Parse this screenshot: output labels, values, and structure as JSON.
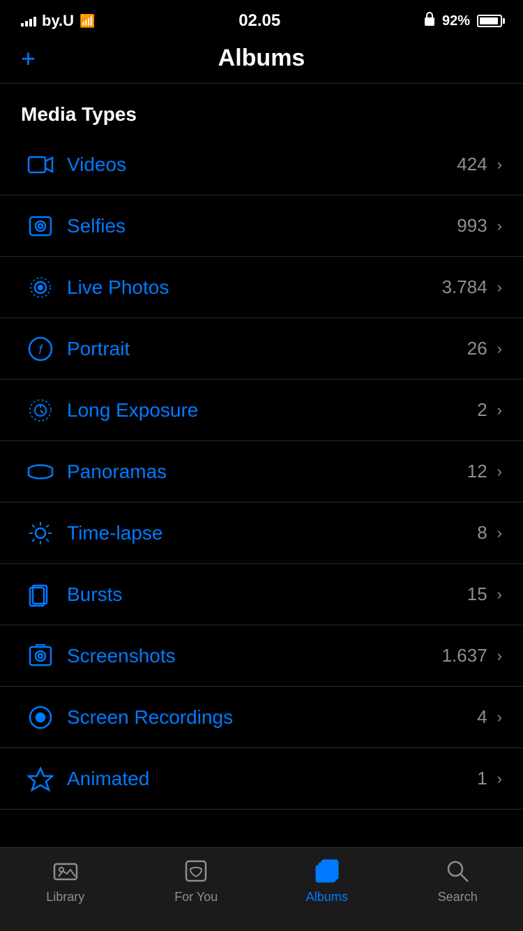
{
  "statusBar": {
    "carrier": "by.U",
    "time": "02.05",
    "batteryPercent": "92%",
    "lockIcon": "🔒"
  },
  "header": {
    "addButton": "+",
    "title": "Albums"
  },
  "mediaTypes": {
    "sectionTitle": "Media Types",
    "items": [
      {
        "id": "videos",
        "label": "Videos",
        "count": "424",
        "icon": "video"
      },
      {
        "id": "selfies",
        "label": "Selfies",
        "count": "993",
        "icon": "selfie"
      },
      {
        "id": "live-photos",
        "label": "Live Photos",
        "count": "3.784",
        "icon": "live"
      },
      {
        "id": "portrait",
        "label": "Portrait",
        "count": "26",
        "icon": "portrait"
      },
      {
        "id": "long-exposure",
        "label": "Long Exposure",
        "count": "2",
        "icon": "long-exposure"
      },
      {
        "id": "panoramas",
        "label": "Panoramas",
        "count": "12",
        "icon": "panorama"
      },
      {
        "id": "time-lapse",
        "label": "Time-lapse",
        "count": "8",
        "icon": "timelapse"
      },
      {
        "id": "bursts",
        "label": "Bursts",
        "count": "15",
        "icon": "bursts"
      },
      {
        "id": "screenshots",
        "label": "Screenshots",
        "count": "1.637",
        "icon": "screenshot"
      },
      {
        "id": "screen-recordings",
        "label": "Screen Recordings",
        "count": "4",
        "icon": "screen-recording"
      },
      {
        "id": "animated",
        "label": "Animated",
        "count": "1",
        "icon": "animated"
      }
    ]
  },
  "tabBar": {
    "items": [
      {
        "id": "library",
        "label": "Library",
        "active": false
      },
      {
        "id": "for-you",
        "label": "For You",
        "active": false
      },
      {
        "id": "albums",
        "label": "Albums",
        "active": true
      },
      {
        "id": "search",
        "label": "Search",
        "active": false
      }
    ]
  }
}
